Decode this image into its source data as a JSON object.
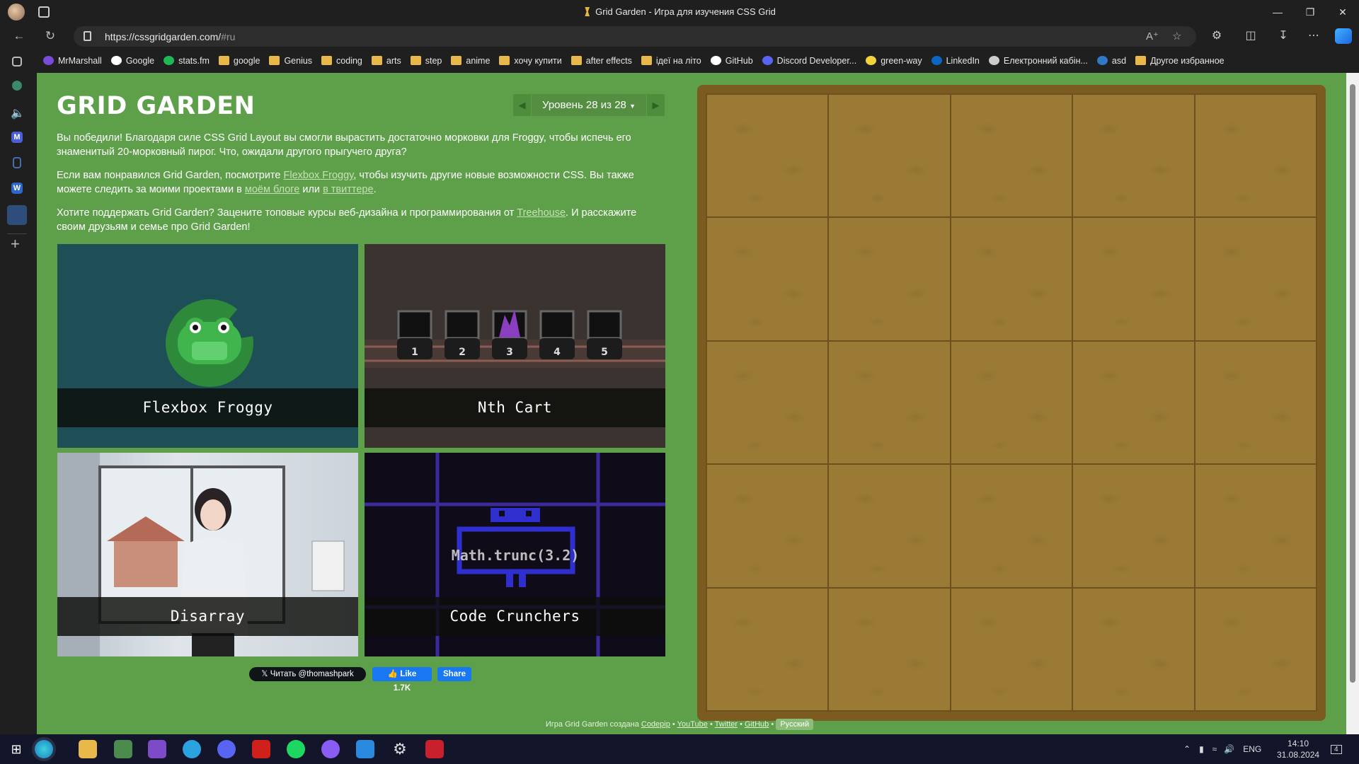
{
  "window": {
    "title": "Grid Garden - Игра для изучения CSS Grid"
  },
  "address": {
    "url_host": "https://cssgridgarden.com/",
    "url_hash": "#ru"
  },
  "bookmarks": [
    {
      "label": "MrMarshall",
      "icon": "m-icon"
    },
    {
      "label": "Google",
      "icon": "google-icon"
    },
    {
      "label": "stats.fm",
      "icon": "stats-icon"
    },
    {
      "label": "google",
      "icon": "folder-icon"
    },
    {
      "label": "Genius",
      "icon": "folder-icon"
    },
    {
      "label": "coding",
      "icon": "folder-icon"
    },
    {
      "label": "arts",
      "icon": "folder-icon"
    },
    {
      "label": "step",
      "icon": "folder-icon"
    },
    {
      "label": "anime",
      "icon": "folder-icon"
    },
    {
      "label": "хочу купити",
      "icon": "folder-icon"
    },
    {
      "label": "after effects",
      "icon": "folder-icon"
    },
    {
      "label": "ідеї на літо",
      "icon": "folder-icon"
    },
    {
      "label": "GitHub",
      "icon": "github-icon"
    },
    {
      "label": "Discord Developer...",
      "icon": "discord-icon"
    },
    {
      "label": "green-way",
      "icon": "diamond-icon"
    },
    {
      "label": "LinkedIn",
      "icon": "linkedin-icon"
    },
    {
      "label": "Електронний кабін...",
      "icon": "document-icon"
    },
    {
      "label": "asd",
      "icon": "ts-icon"
    }
  ],
  "bookmarks_other": "Другое избранное",
  "game": {
    "logo": "GRID GARDEN",
    "level_label": "Уровень 28 из 28",
    "win_text": "Вы победили! Благодаря силе CSS Grid Layout вы смогли вырастить достаточно морковки для Froggy, чтобы испечь его знаменитый 20-морковный пирог. Что, ожидали другого прыгучего друга?",
    "para2_a": "Если вам понравился Grid Garden, посмотрите ",
    "para2_link1": "Flexbox Froggy",
    "para2_b": ", чтобы изучить другие новые возможности CSS. Вы также можете следить за моими проектами в ",
    "para2_link2": "моём блоге",
    "para2_c": " или ",
    "para2_link3": "в твиттере",
    "para2_d": ".",
    "para3_a": "Хотите поддержать Grid Garden? Зацените топовые курсы веб-дизайна и программирования от ",
    "para3_link": "Treehouse",
    "para3_b": ". И расскажите своим друзьям и семье про Grid Garden!",
    "cards": [
      {
        "title": "Flexbox Froggy"
      },
      {
        "title": "Nth Cart",
        "cart_numbers": [
          "1",
          "2",
          "3",
          "4",
          "5"
        ]
      },
      {
        "title": "Disarray"
      },
      {
        "title": "Code Crunchers",
        "code": "Math.trunc(3.2)"
      }
    ],
    "twitter_btn": "Читать @thomashpark",
    "fb_like": "Like 1.7K",
    "fb_share": "Share",
    "footer_prefix": "Игра Grid Garden создана ",
    "footer_links": [
      "Codepip",
      "YouTube",
      "Twitter",
      "GitHub"
    ],
    "footer_sep": "•",
    "footer_lang": "Русский"
  },
  "tray": {
    "lang": "ENG",
    "time": "14:10",
    "date": "31.08.2024",
    "notif_count": "4"
  },
  "colors": {
    "page_bg": "#5ea04a",
    "soil": "#9a7a35",
    "board_frame": "#7b5b1f"
  }
}
